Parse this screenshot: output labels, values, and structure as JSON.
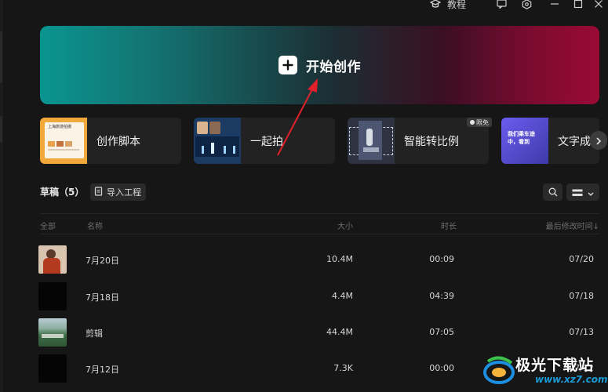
{
  "titlebar": {
    "tutorial_label": "教程",
    "icons": [
      "graduation-cap-icon",
      "feedback-icon",
      "settings-hex-icon",
      "minimize-icon",
      "maximize-icon",
      "close-icon"
    ]
  },
  "hero": {
    "label": "开始创作",
    "gradient_start": "#0a9590",
    "gradient_end": "#9a0a37"
  },
  "cards": [
    {
      "label": "创作脚本",
      "thumb_text": "上海旅游拍摄"
    },
    {
      "label": "一起拍"
    },
    {
      "label": "智能转比例",
      "badge": "限免"
    },
    {
      "label": "文字成",
      "thumb_text": "我们乘车途中，看到"
    }
  ],
  "drafts": {
    "title": "草稿（5）",
    "import_label": "导入工程"
  },
  "columns": {
    "all": "全部",
    "name": "名称",
    "size": "大小",
    "duration": "时长",
    "modified": "最后修改时间↓"
  },
  "rows": [
    {
      "name": "7月20日",
      "size": "10.4M",
      "duration": "00:09",
      "date": "07/20",
      "thumb": "person"
    },
    {
      "name": "7月18日",
      "size": "4.4M",
      "duration": "04:39",
      "date": "07/18",
      "thumb": "black"
    },
    {
      "name": "剪辑",
      "size": "44.4M",
      "duration": "07:05",
      "date": "07/13",
      "thumb": "landscape"
    },
    {
      "name": "7月12日",
      "size": "7.3K",
      "duration": "00:00",
      "date": "07/12",
      "thumb": "black"
    }
  ],
  "annotation_arrow_color": "#e0202a",
  "watermark": {
    "text": "极光下载站",
    "url": "www.xz7.com"
  }
}
